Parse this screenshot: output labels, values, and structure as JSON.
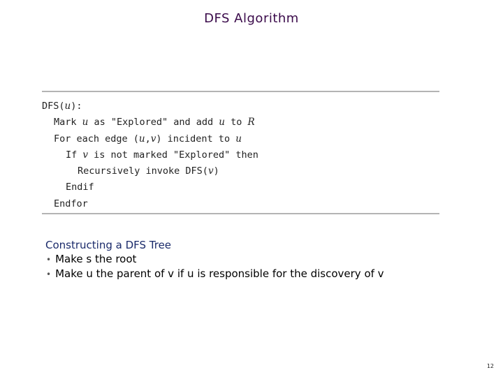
{
  "slide": {
    "title": "DFS Algorithm",
    "page_number": "12"
  },
  "algorithm": {
    "lines": [
      {
        "parts": [
          "DFS(",
          "u",
          "):"
        ]
      },
      {
        "parts": [
          "Mark ",
          "u",
          " as \"Explored\" and add ",
          "u",
          " to ",
          "R"
        ]
      },
      {
        "parts": [
          "For each edge (",
          "u",
          ",",
          "v",
          ") incident to ",
          "u"
        ]
      },
      {
        "parts": [
          "If ",
          "v",
          " is not marked \"Explored\" then"
        ]
      },
      {
        "parts": [
          "Recursively invoke DFS(",
          "v",
          ")"
        ]
      },
      {
        "parts": [
          "Endif"
        ]
      },
      {
        "parts": [
          "Endfor"
        ]
      }
    ]
  },
  "notes": {
    "heading": "Constructing a DFS Tree",
    "bullet_glyph": "•",
    "bullets": [
      "Make s the root",
      "Make u the parent of v if u is responsible for the discovery of v"
    ]
  },
  "colors": {
    "title": "#3a0a4a",
    "heading": "#1a2a6a",
    "rule": "#b4b4b4"
  }
}
